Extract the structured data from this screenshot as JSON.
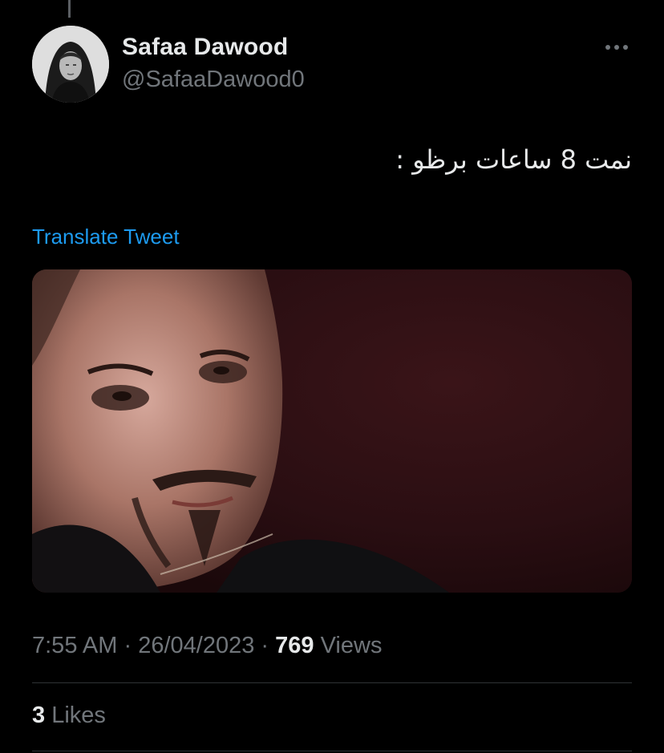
{
  "tweet": {
    "author": {
      "display_name": "Safaa Dawood",
      "handle": "@SafaaDawood0",
      "avatar_icon": "user-avatar"
    },
    "more_icon": "more-horizontal-icon",
    "text": "نمت 8 ساعات برظو :",
    "translate_label": "Translate Tweet",
    "media": {
      "kind": "photo"
    },
    "time": "7:55 AM",
    "separator": "·",
    "date": "26/04/2023",
    "views_count": "769",
    "views_label": "Views",
    "likes_count": "3",
    "likes_label": "Likes"
  },
  "colors": {
    "background": "#000000",
    "primary_text": "#e7e9ea",
    "secondary_text": "#71767b",
    "accent": "#1d9bf0",
    "divider": "#2f3336"
  }
}
